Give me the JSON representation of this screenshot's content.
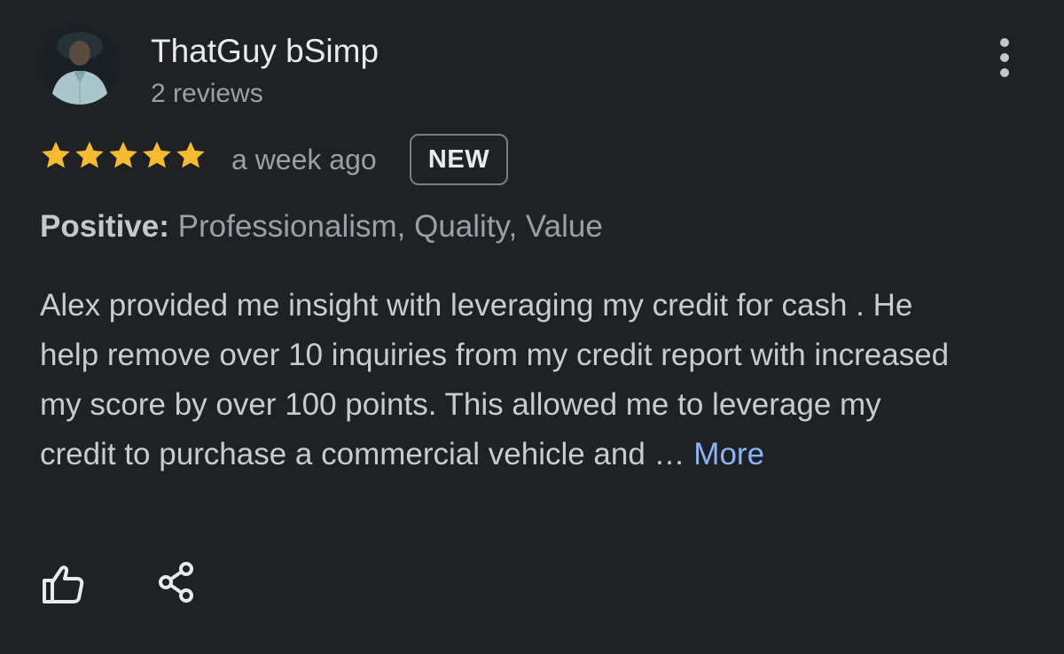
{
  "review": {
    "author_name": "ThatGuy bSimp",
    "author_review_count": "2 reviews",
    "rating": 5,
    "rating_max": 5,
    "star_color": "#f6bb2f",
    "timestamp": "a week ago",
    "badge": "NEW",
    "attributes_label": "Positive:",
    "attributes_values": "Professionalism, Quality, Value",
    "text": "Alex provided me insight with leveraging my credit for cash . He help remove over 10 inquiries from my credit report with increased my score by over 100 points. This allowed me to leverage my credit to purchase a commercial vehicle and …",
    "more_label": "More",
    "link_color": "#8ab4f8"
  },
  "icons": {
    "avatar": "avatar-photo",
    "menu": "more-vert-icon",
    "star": "star-icon",
    "like": "thumb-up-icon",
    "share": "share-icon"
  }
}
